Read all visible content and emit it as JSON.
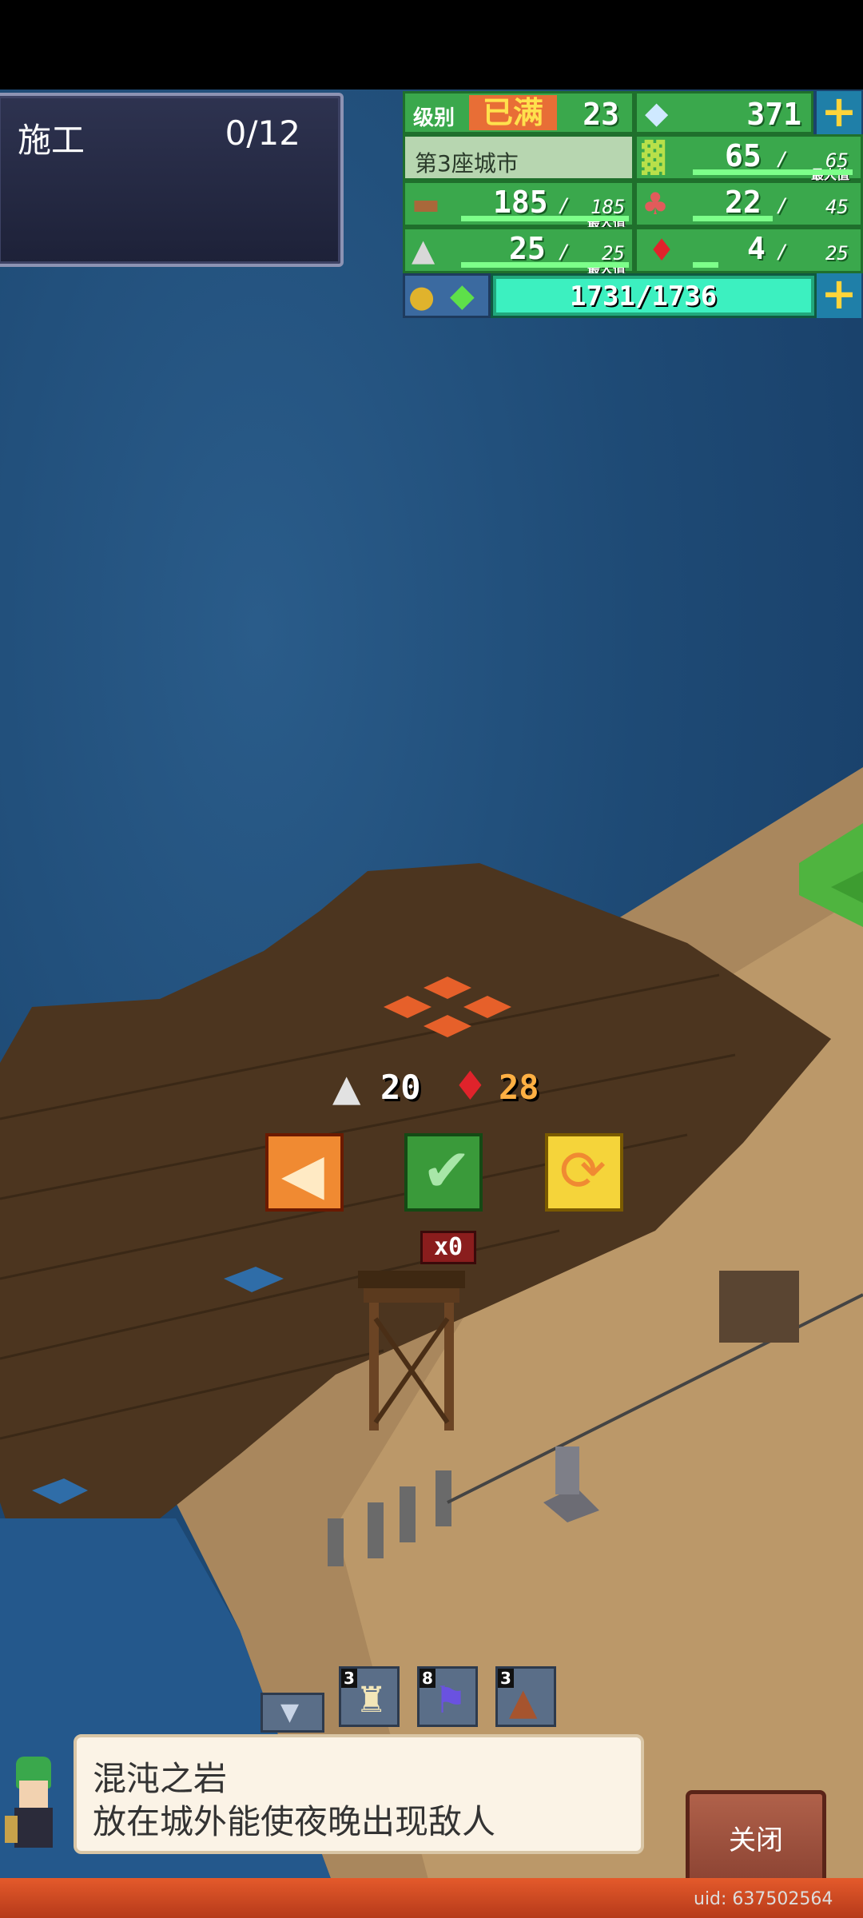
{
  "construction": {
    "title": "施工",
    "count": "0/12"
  },
  "resources": {
    "level_label": "级别",
    "level_status": "已满",
    "level_value": "23",
    "gems": "371",
    "city_name": "第3座城市",
    "max_label": "最大值",
    "crops": {
      "value": "65",
      "max": "65"
    },
    "wood": {
      "value": "185",
      "max": "185"
    },
    "food": {
      "value": "22",
      "max": "45"
    },
    "stone": {
      "value": "25",
      "max": "25"
    },
    "ruby": {
      "value": "4",
      "max": "25"
    },
    "energy": "1731/1736",
    "plus_symbol": "+"
  },
  "cost": {
    "stone": "20",
    "ruby": "28"
  },
  "placement_counter": "x0",
  "toolbar": {
    "items": [
      {
        "name": "castle-tool",
        "level": "3"
      },
      {
        "name": "flag-tool",
        "level": "8"
      },
      {
        "name": "cave-tool",
        "level": "3"
      }
    ]
  },
  "dialog": {
    "title": "混沌之岩",
    "description": "放在城外能使夜晚出现敌人"
  },
  "close_label": "关闭",
  "uid": "uid: 637502564",
  "colors": {
    "accent_green": "#3aa84c",
    "ui_dark": "#1d2138",
    "close_button": "#9c4d39"
  }
}
